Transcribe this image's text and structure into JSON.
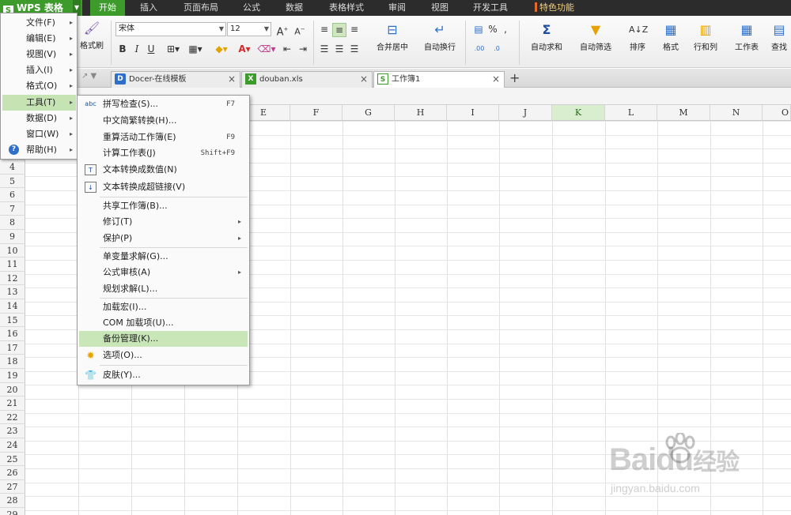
{
  "app": {
    "name": "WPS 表格",
    "logo_letter": "S"
  },
  "menubar": {
    "tabs": [
      {
        "label": "开始",
        "active": true
      },
      {
        "label": "插入"
      },
      {
        "label": "页面布局"
      },
      {
        "label": "公式"
      },
      {
        "label": "数据"
      },
      {
        "label": "表格样式"
      },
      {
        "label": "审阅"
      },
      {
        "label": "视图"
      },
      {
        "label": "开发工具"
      },
      {
        "label": "特色功能"
      }
    ]
  },
  "ribbon": {
    "format_painter": "格式刷",
    "font_name": "宋体",
    "font_size": "12",
    "bold": "B",
    "italic": "I",
    "underline": "U",
    "merge_center": "合并居中",
    "wrap_text": "自动换行",
    "percent": "%",
    "autosum": "自动求和",
    "autofilter": "自动筛选",
    "sort": "排序",
    "format": "格式",
    "rows_cols": "行和列",
    "worksheet": "工作表",
    "find": "查找"
  },
  "doc_tabs": [
    {
      "label": "Docer-在线模板"
    },
    {
      "label": "douban.xls"
    },
    {
      "label": "工作簿1",
      "active": true
    }
  ],
  "grid": {
    "columns": [
      "E",
      "F",
      "G",
      "H",
      "I",
      "J",
      "K",
      "L",
      "M",
      "N",
      "O"
    ],
    "selected_column": "K",
    "rows": [
      "4",
      "5",
      "6",
      "7",
      "8",
      "9",
      "10",
      "11",
      "12",
      "13",
      "14",
      "15",
      "16",
      "17",
      "18",
      "19",
      "20",
      "21",
      "22",
      "23",
      "24",
      "25",
      "26",
      "27",
      "28",
      "29"
    ]
  },
  "app_menu": {
    "items": [
      {
        "label": "文件(F)"
      },
      {
        "label": "编辑(E)"
      },
      {
        "label": "视图(V)"
      },
      {
        "label": "插入(I)"
      },
      {
        "label": "格式(O)"
      },
      {
        "label": "工具(T)",
        "highlighted": true
      },
      {
        "label": "数据(D)"
      },
      {
        "label": "窗口(W)"
      },
      {
        "label": "帮助(H)"
      }
    ]
  },
  "tools_menu": {
    "items": [
      {
        "label": "拼写检查(S)...",
        "shortcut": "F7"
      },
      {
        "label": "中文简繁转换(H)..."
      },
      {
        "label": "重算活动工作簿(E)",
        "shortcut": "F9"
      },
      {
        "label": "计算工作表(J)",
        "shortcut": "Shift+F9"
      },
      {
        "label": "文本转换成数值(N)"
      },
      {
        "label": "文本转换成超链接(V)"
      },
      {
        "label": "共享工作簿(B)..."
      },
      {
        "label": "修订(T)"
      },
      {
        "label": "保护(P)"
      },
      {
        "label": "单变量求解(G)..."
      },
      {
        "label": "公式审核(A)"
      },
      {
        "label": "规划求解(L)..."
      },
      {
        "label": "加载宏(I)..."
      },
      {
        "label": "COM 加载项(U)..."
      },
      {
        "label": "备份管理(K)...",
        "highlighted": true
      },
      {
        "label": "选项(O)..."
      },
      {
        "label": "皮肤(Y)..."
      }
    ]
  },
  "watermark": {
    "brand": "Baidu",
    "brand_cn": "经验",
    "url": "jingyan.baidu.com"
  }
}
